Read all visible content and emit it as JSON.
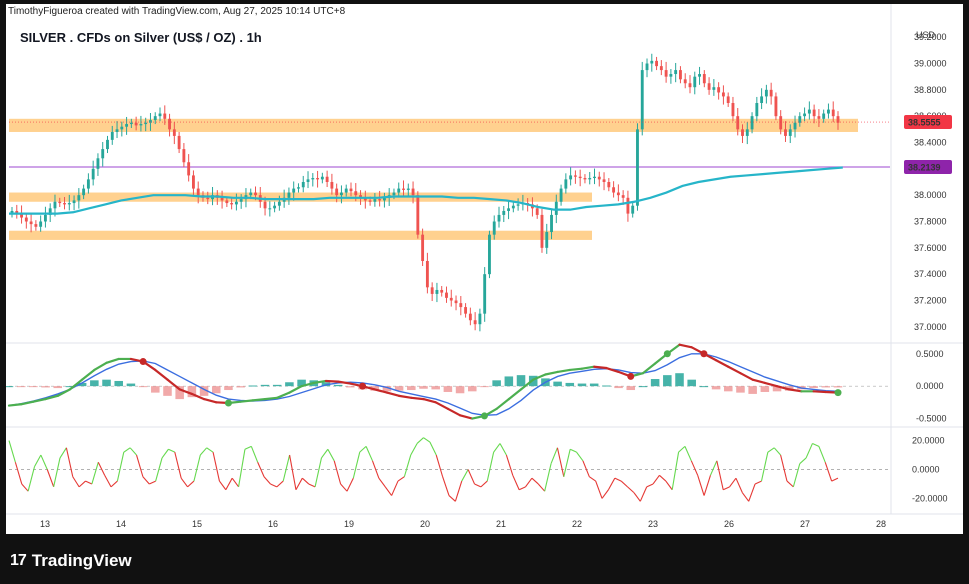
{
  "header": {
    "attribution": "TimothyFigueroa created with TradingView.com, Aug 27, 2025 10:14 UTC+8",
    "title": "SILVER . CFDs on Silver (US$ / OZ) . 1h",
    "currency": "USD"
  },
  "footer": {
    "brand": "TradingView",
    "logo_glyph": "17"
  },
  "colors": {
    "up": "#26a69a",
    "down": "#ef5350",
    "ema": "#26b5c9",
    "zone": "#ffc26a",
    "purple_line": "#b16cdb",
    "price_tag": "#f23645",
    "purple_tag": "#8e24aa",
    "macd_fast": "#4caf50",
    "macd_slow": "#c62828",
    "stoch_up": "#66d94f",
    "stoch_down": "#e53935"
  },
  "chart_data": [
    {
      "type": "candlestick",
      "title": "SILVER . CFDs on Silver (US$ / OZ) . 1h",
      "ylim": [
        36.9,
        39.3
      ],
      "y_ticks": [
        "39.2000",
        "39.0000",
        "38.8000",
        "38.6000",
        "38.4000",
        "38.2000",
        "38.0000",
        "37.8000",
        "37.6000",
        "37.4000",
        "37.2000",
        "37.0000"
      ],
      "x_ticks": [
        "13",
        "14",
        "15",
        "16",
        "19",
        "20",
        "21",
        "22",
        "23",
        "26",
        "27",
        "28"
      ],
      "closes": [
        37.88,
        37.86,
        37.83,
        37.8,
        37.78,
        37.76,
        37.8,
        37.85,
        37.9,
        37.95,
        37.94,
        37.93,
        37.94,
        37.96,
        38.0,
        38.05,
        38.12,
        38.2,
        38.28,
        38.35,
        38.42,
        38.48,
        38.5,
        38.52,
        38.54,
        38.55,
        38.53,
        38.54,
        38.55,
        38.57,
        38.6,
        38.62,
        38.58,
        38.5,
        38.45,
        38.35,
        38.25,
        38.15,
        38.05,
        38.0,
        37.98,
        37.97,
        38.0,
        37.98,
        37.96,
        37.94,
        37.93,
        37.95,
        37.97,
        38.0,
        38.02,
        38.0,
        37.95,
        37.9,
        37.9,
        37.92,
        37.95,
        37.98,
        38.02,
        38.05,
        38.06,
        38.1,
        38.12,
        38.13,
        38.12,
        38.14,
        38.1,
        38.05,
        38.0,
        38.02,
        38.05,
        38.03,
        38.0,
        37.98,
        37.96,
        37.95,
        37.97,
        37.96,
        37.98,
        38.0,
        38.02,
        38.05,
        38.04,
        38.05,
        38.0,
        37.7,
        37.5,
        37.3,
        37.25,
        37.28,
        37.26,
        37.22,
        37.2,
        37.18,
        37.15,
        37.1,
        37.05,
        37.02,
        37.1,
        37.4,
        37.7,
        37.8,
        37.85,
        37.88,
        37.9,
        37.92,
        37.93,
        37.94,
        37.93,
        37.9,
        37.85,
        37.6,
        37.72,
        37.85,
        37.95,
        38.05,
        38.12,
        38.15,
        38.14,
        38.13,
        38.12,
        38.13,
        38.14,
        38.12,
        38.1,
        38.06,
        38.02,
        38.0,
        37.98,
        37.86,
        37.92,
        38.5,
        38.95,
        39.0,
        39.02,
        38.98,
        38.95,
        38.9,
        38.92,
        38.95,
        38.88,
        38.85,
        38.82,
        38.9,
        38.92,
        38.85,
        38.8,
        38.82,
        38.78,
        38.75,
        38.7,
        38.6,
        38.5,
        38.45,
        38.5,
        38.6,
        38.7,
        38.75,
        38.8,
        38.75,
        38.6,
        38.5,
        38.45,
        38.5,
        38.55,
        38.6,
        38.62,
        38.65,
        38.6,
        38.58,
        38.62,
        38.65,
        38.6,
        38.55
      ],
      "ema": [
        37.86,
        37.86,
        37.86,
        37.86,
        37.87,
        37.9,
        37.93,
        37.96,
        37.98,
        38.0,
        38.0,
        38.0,
        37.99,
        37.99,
        37.98,
        37.98,
        37.97,
        37.97,
        37.97,
        37.97,
        37.98,
        37.98,
        37.98,
        37.98,
        37.99,
        37.99,
        37.99,
        37.99,
        37.98,
        37.98,
        37.97,
        37.96,
        37.94,
        37.91,
        37.89,
        37.89,
        37.91,
        37.92,
        37.93,
        37.95,
        37.98,
        38.02,
        38.07,
        38.1,
        38.12,
        38.14,
        38.15,
        38.16,
        38.17,
        38.18,
        38.19,
        38.2,
        38.21
      ],
      "ema_x_range": [
        0,
        174
      ],
      "support_zones": [
        {
          "low": 38.48,
          "high": 38.58
        },
        {
          "low": 37.95,
          "high": 38.02
        },
        {
          "low": 37.66,
          "high": 37.73
        }
      ],
      "horizontal_line": 38.2139,
      "current_price": "38.5555",
      "line_price": "38.2139"
    },
    {
      "type": "macd",
      "ylim": [
        -0.6,
        0.62
      ],
      "y_ticks": [
        "0.5000",
        "0.0000",
        "-0.5000"
      ],
      "macd": [
        -0.3,
        -0.28,
        -0.24,
        -0.2,
        -0.15,
        -0.05,
        0.1,
        0.25,
        0.36,
        0.42,
        0.42,
        0.38,
        0.25,
        0.1,
        -0.05,
        -0.12,
        -0.2,
        -0.25,
        -0.26,
        -0.24,
        -0.22,
        -0.2,
        -0.18,
        -0.1,
        0.0,
        0.05,
        0.08,
        0.07,
        0.04,
        0.0,
        -0.05,
        -0.1,
        -0.15,
        -0.18,
        -0.2,
        -0.25,
        -0.35,
        -0.45,
        -0.5,
        -0.46,
        -0.35,
        -0.2,
        -0.05,
        0.1,
        0.18,
        0.22,
        0.25,
        0.27,
        0.3,
        0.28,
        0.22,
        0.15,
        0.2,
        0.35,
        0.5,
        0.64,
        0.6,
        0.5,
        0.4,
        0.3,
        0.2,
        0.1,
        0.05,
        0.0,
        -0.05,
        -0.08,
        -0.08,
        -0.09,
        -0.1
      ],
      "signal": [
        -0.3,
        -0.27,
        -0.23,
        -0.18,
        -0.12,
        -0.05,
        0.05,
        0.16,
        0.26,
        0.34,
        0.38,
        0.39,
        0.35,
        0.25,
        0.15,
        0.05,
        -0.05,
        -0.14,
        -0.2,
        -0.22,
        -0.23,
        -0.22,
        -0.2,
        -0.16,
        -0.1,
        -0.04,
        0.02,
        0.05,
        0.06,
        0.05,
        0.02,
        -0.02,
        -0.08,
        -0.12,
        -0.16,
        -0.2,
        -0.26,
        -0.34,
        -0.42,
        -0.45,
        -0.44,
        -0.35,
        -0.22,
        -0.06,
        0.06,
        0.15,
        0.2,
        0.23,
        0.26,
        0.27,
        0.25,
        0.21,
        0.2,
        0.24,
        0.33,
        0.44,
        0.5,
        0.5,
        0.45,
        0.38,
        0.3,
        0.22,
        0.14,
        0.08,
        0.02,
        -0.03,
        -0.05,
        -0.07,
        -0.08
      ],
      "hist": [
        0.0,
        -0.01,
        -0.01,
        -0.02,
        -0.03,
        0.0,
        0.05,
        0.09,
        0.1,
        0.08,
        0.04,
        -0.01,
        -0.1,
        -0.15,
        -0.2,
        -0.17,
        -0.15,
        -0.11,
        -0.06,
        -0.02,
        0.01,
        0.02,
        0.02,
        0.06,
        0.1,
        0.09,
        0.06,
        0.02,
        -0.02,
        -0.05,
        -0.07,
        -0.08,
        -0.07,
        -0.06,
        -0.04,
        -0.05,
        -0.09,
        -0.11,
        -0.08,
        -0.01,
        0.09,
        0.15,
        0.17,
        0.16,
        0.12,
        0.07,
        0.05,
        0.04,
        0.04,
        0.01,
        -0.03,
        -0.06,
        0.0,
        0.11,
        0.17,
        0.2,
        0.1,
        0.0,
        -0.05,
        -0.08,
        -0.1,
        -0.12,
        -0.09,
        -0.08,
        -0.07,
        -0.05,
        -0.03,
        -0.02,
        -0.02
      ],
      "cross_up_idx": [
        18,
        39,
        54,
        68
      ],
      "cross_down_idx": [
        11,
        29,
        51,
        57
      ]
    },
    {
      "type": "oscillator",
      "ylim": [
        -28,
        28
      ],
      "y_ticks": [
        "20.0000",
        "0.0000",
        "-20.0000"
      ],
      "values": [
        20,
        5,
        -10,
        -15,
        2,
        10,
        0,
        -12,
        8,
        15,
        -5,
        -12,
        -8,
        -10,
        5,
        -4,
        -12,
        -8,
        12,
        15,
        10,
        -5,
        -10,
        -8,
        8,
        14,
        12,
        -6,
        -12,
        -8,
        10,
        15,
        12,
        -8,
        -14,
        -6,
        -12,
        14,
        16,
        5,
        -5,
        -10,
        -12,
        -8,
        10,
        -14,
        -6,
        -10,
        -12,
        8,
        14,
        6,
        -10,
        -15,
        -6,
        12,
        16,
        6,
        -6,
        -12,
        -18,
        -8,
        -5,
        10,
        18,
        22,
        19,
        10,
        -5,
        -18,
        -22,
        -8,
        0,
        -10,
        -12,
        -8,
        12,
        18,
        10,
        -4,
        -14,
        -12,
        -6,
        -10,
        -15,
        4,
        15,
        -5,
        14,
        12,
        6,
        -5,
        -8,
        -20,
        -14,
        -6,
        -8,
        -12,
        -16,
        -22,
        -12,
        -10,
        -4,
        -8,
        -14,
        12,
        16,
        6,
        -4,
        -18,
        -4,
        6,
        -14,
        -12,
        -6,
        -16,
        -22,
        -10,
        -8,
        12,
        15,
        10,
        -8,
        -12,
        4,
        8,
        18,
        16,
        5,
        -8,
        -6
      ],
      "midline": 0
    }
  ]
}
